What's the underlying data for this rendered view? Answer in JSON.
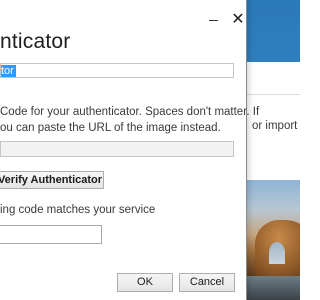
{
  "dialog": {
    "title": "nticator",
    "name_value": "tor",
    "instructions_line1": "Code for your authenticator. Spaces don't matter. If",
    "instructions_line2": "ou can paste the URL of the image instead.",
    "verify_button_label": "Verify Authenticator",
    "verify_note": "ing code matches your service",
    "ok_label": "OK",
    "cancel_label": "Cancel",
    "close_glyph": "✕"
  },
  "background": {
    "text_fragment": "or import y"
  },
  "colors": {
    "selection": "#3399ff",
    "header_blue": "#2b79b8"
  }
}
